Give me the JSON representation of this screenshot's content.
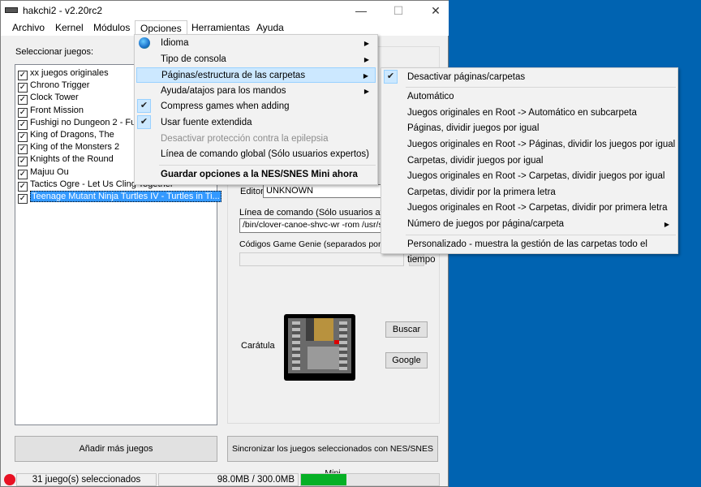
{
  "window": {
    "title": "hakchi2 - v2.20rc2",
    "minimize": "—",
    "maximize": "☐",
    "close": "✕"
  },
  "menubar": [
    "Archivo",
    "Kernel",
    "Módulos",
    "Opciones",
    "Herramientas",
    "Ayuda"
  ],
  "options_menu": [
    {
      "label": "Idioma",
      "icon": "globe-icon",
      "submenu": true
    },
    {
      "label": "Tipo de consola",
      "submenu": true
    },
    {
      "label": "Páginas/estructura de las carpetas",
      "submenu": true,
      "highlighted": true
    },
    {
      "label": "Ayuda/atajos para los mandos",
      "submenu": true
    },
    {
      "label": "Compress games when adding",
      "checked": true
    },
    {
      "label": "Usar fuente extendida",
      "checked": true
    },
    {
      "label": "Desactivar protección contra la epilepsia",
      "disabled": true
    },
    {
      "label": "Línea de comando global (Sólo usuarios expertos)"
    },
    {
      "label": "Guardar opciones a la NES/SNES Mini ahora",
      "bold": true
    }
  ],
  "folders_submenu": [
    {
      "label": "Desactivar páginas/carpetas",
      "checked": true
    },
    {
      "label": "Automático"
    },
    {
      "label": "Juegos originales en Root -> Automático en subcarpeta"
    },
    {
      "label": "Páginas, dividir juegos por igual"
    },
    {
      "label": "Juegos originales en Root -> Páginas, dividir los juegos por igual"
    },
    {
      "label": "Carpetas, dividir juegos por igual"
    },
    {
      "label": "Juegos originales en Root -> Carpetas, dividir juegos por igual"
    },
    {
      "label": "Carpetas, dividir por la primera letra"
    },
    {
      "label": "Juegos originales en Root -> Carpetas, dividir por primera letra"
    },
    {
      "label": "Número de juegos por página/carpeta",
      "submenu": true
    },
    {
      "label": "Personalizado - muestra la gestión de las carpetas todo el tiempo"
    }
  ],
  "games": {
    "label": "Seleccionar juegos:",
    "items": [
      "xx juegos originales",
      "Chrono Trigger",
      "Clock Tower",
      "Front Mission",
      "Fushigi no Dungeon 2 - Fuurai",
      "King of Dragons, The",
      "King of the Monsters 2",
      "Knights of the Round",
      "Majuu Ou",
      "Tactics Ogre - Let Us Cling Together",
      "Teenage Mutant Ninja Turtles IV - Turtles in Ti..."
    ],
    "selected_index": 10
  },
  "details": {
    "editor_label": "Editor:",
    "editor_value": "UNKNOWN",
    "cmd_label": "Línea de comando (Sólo usuarios avanzados)",
    "cmd_value": "/bin/clover-canoe-shvc-wr -rom /usr/share",
    "genie_label": "Códigos Game Genie (separados por comas)",
    "genie_value": "",
    "genie_add": "+",
    "cover_label": "Carátula",
    "buscar": "Buscar",
    "google": "Google"
  },
  "buttons": {
    "add": "Añadir más juegos",
    "sync": "Sincronizar los juegos seleccionados con NES/SNES Mini"
  },
  "status": {
    "selected": "31 juego(s) seleccionados",
    "size": "98.0MB / 300.0MB",
    "usage_fraction": 0.327,
    "indicator_color": "#e81123",
    "bar_color": "#06b025"
  }
}
